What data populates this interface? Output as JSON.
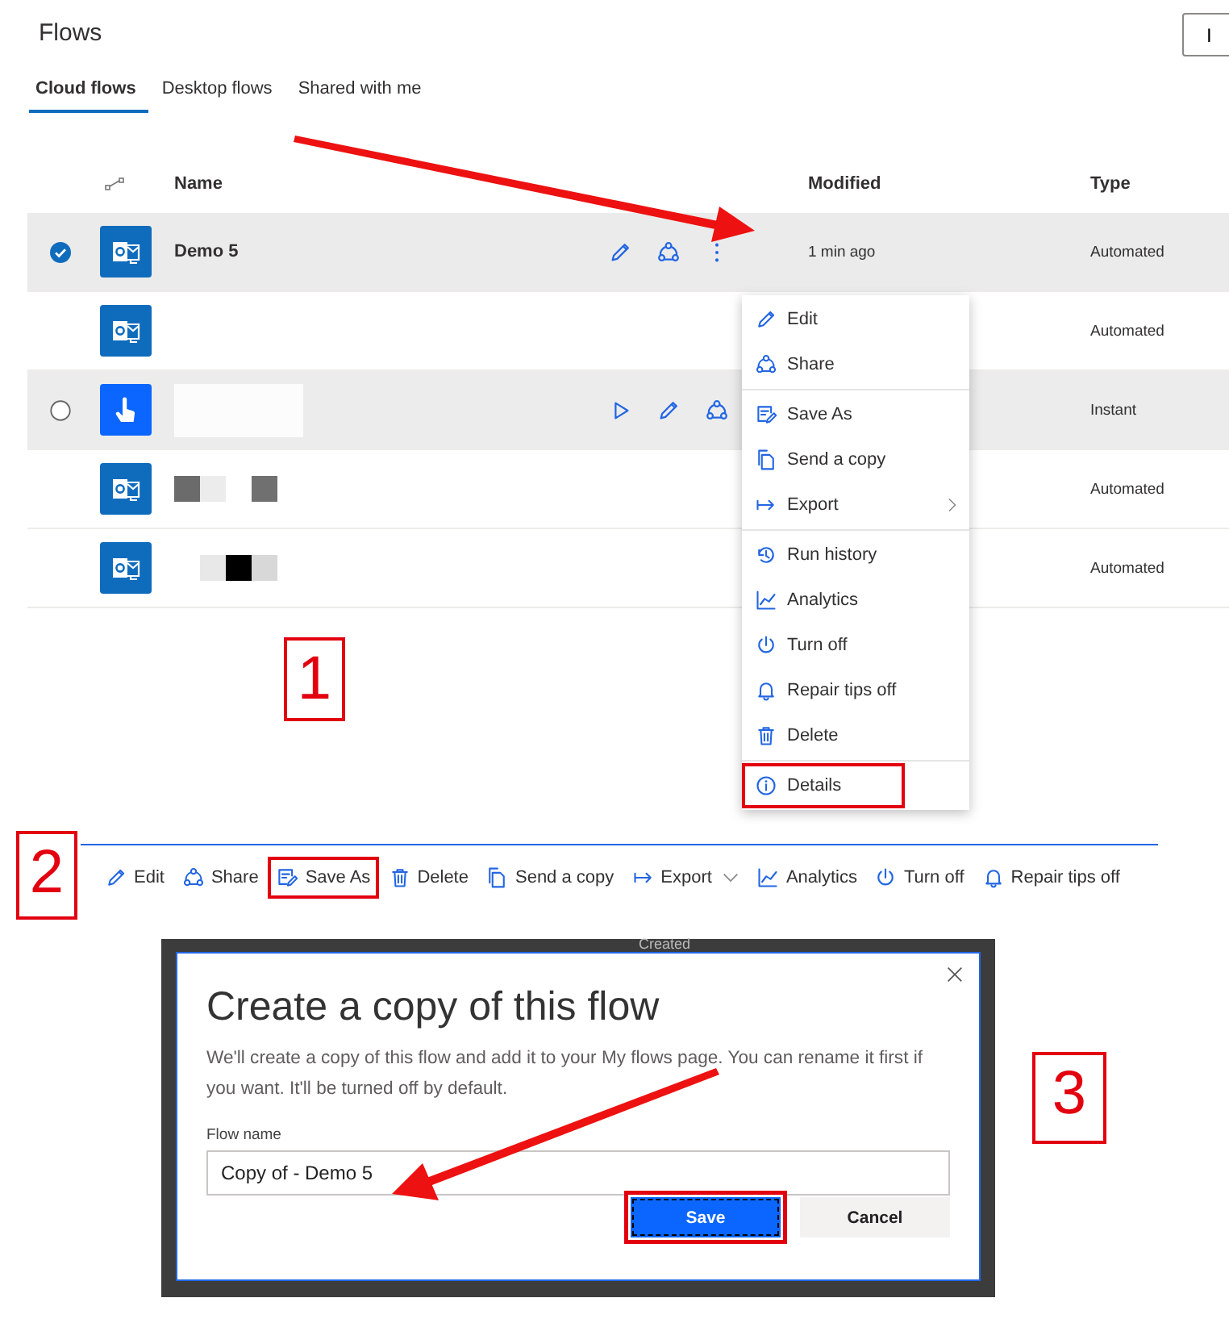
{
  "page": {
    "title": "Flows",
    "corner_button": "I"
  },
  "tabs": [
    {
      "label": "Cloud flows",
      "selected": true
    },
    {
      "label": "Desktop flows",
      "selected": false
    },
    {
      "label": "Shared with me",
      "selected": false
    }
  ],
  "table": {
    "columns": [
      {
        "label": "Name"
      },
      {
        "label": "Modified"
      },
      {
        "label": "Type"
      }
    ],
    "rows": [
      {
        "tile": {
          "kind": "outlook"
        },
        "selected": true,
        "hovered": false,
        "name": "Demo 5",
        "actions": [
          {
            "kind": "edit"
          },
          {
            "kind": "share"
          },
          {
            "kind": "more"
          }
        ],
        "modified": "1 min ago",
        "type": "Automated"
      },
      {
        "tile": {
          "kind": "outlook"
        },
        "selected": false,
        "hovered": false,
        "type": "Automated"
      },
      {
        "tile": {
          "kind": "touch"
        },
        "selected": false,
        "hovered": true,
        "censor": {
          "kind": "patch"
        },
        "actions": [
          {
            "kind": "run"
          },
          {
            "kind": "edit"
          },
          {
            "kind": "share"
          }
        ],
        "type": "Instant"
      },
      {
        "tile": {
          "kind": "outlook"
        },
        "selected": false,
        "hovered": false,
        "censor": {
          "kind": "mosaic",
          "cells": [
            {
              "color": "#6b6b6b"
            },
            {
              "color": "#ececec"
            },
            {
              "color": "#ffffff"
            },
            {
              "color": "#707070"
            }
          ]
        },
        "type": "Automated"
      },
      {
        "tile": {
          "kind": "outlook"
        },
        "selected": false,
        "hovered": false,
        "censor": {
          "kind": "mosaic",
          "cells": [
            {
              "color": "#ffffff"
            },
            {
              "color": "#e8e8e8"
            },
            {
              "color": "#000000"
            },
            {
              "color": "#d8d8d8"
            }
          ]
        },
        "type": "Automated"
      }
    ]
  },
  "menu": {
    "groups": [
      [
        {
          "label": "Edit",
          "kind": "edit",
          "highlighted": false
        },
        {
          "label": "Share",
          "kind": "share",
          "highlighted": false
        }
      ],
      [
        {
          "label": "Save As",
          "kind": "saveas",
          "highlighted": false
        },
        {
          "label": "Send a copy",
          "kind": "copy",
          "highlighted": false
        },
        {
          "label": "Export",
          "kind": "export",
          "submenu": true,
          "highlighted": false
        }
      ],
      [
        {
          "label": "Run history",
          "kind": "history",
          "highlighted": false
        },
        {
          "label": "Analytics",
          "kind": "analytics",
          "highlighted": false
        },
        {
          "label": "Turn off",
          "kind": "power",
          "highlighted": false
        },
        {
          "label": "Repair tips off",
          "kind": "bell",
          "highlighted": false
        },
        {
          "label": "Delete",
          "kind": "delete",
          "highlighted": false
        }
      ],
      [
        {
          "label": "Details",
          "kind": "info",
          "highlighted": true
        }
      ]
    ]
  },
  "toolbar": [
    {
      "label": "Edit",
      "kind": "edit",
      "highlighted": false
    },
    {
      "label": "Share",
      "kind": "share",
      "highlighted": false
    },
    {
      "label": "Save As",
      "kind": "saveas",
      "highlighted": true
    },
    {
      "label": "Delete",
      "kind": "delete",
      "highlighted": false
    },
    {
      "label": "Send a copy",
      "kind": "copy",
      "highlighted": false
    },
    {
      "label": "Export",
      "kind": "export",
      "dropdown": true,
      "highlighted": false
    },
    {
      "label": "Analytics",
      "kind": "analytics",
      "highlighted": false
    },
    {
      "label": "Turn off",
      "kind": "power",
      "highlighted": false
    },
    {
      "label": "Repair tips off",
      "kind": "bell",
      "highlighted": false
    }
  ],
  "dialog": {
    "backdrop_text": "Created",
    "title": "Create a copy of this flow",
    "description": "We'll create a copy of this flow and add it to your My flows page. You can rename it first if you want. It'll be turned off by default.",
    "field_label": "Flow name",
    "value": "Copy of - Demo 5",
    "buttons": [
      {
        "label": "Save",
        "kind": "primary",
        "highlighted": true
      },
      {
        "label": "Cancel",
        "kind": "secondary",
        "highlighted": false
      }
    ]
  },
  "annotations": [
    "1",
    "2",
    "3"
  ]
}
